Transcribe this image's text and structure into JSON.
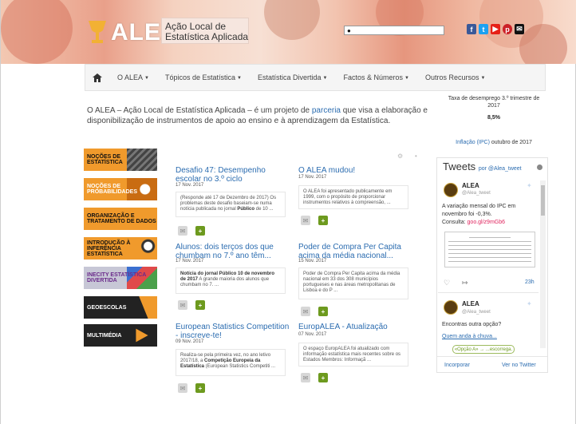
{
  "header": {
    "logo_text": "ALEA",
    "logo_subtitle_line1": "Ação Local de",
    "logo_subtitle_line2": "Estatística Aplicada",
    "search_placeholder": "",
    "social_icons": [
      "facebook-icon",
      "twitter-icon",
      "youtube-icon",
      "pinterest-icon",
      "email-icon"
    ]
  },
  "nav": {
    "home_icon": "home-icon",
    "items": [
      "O ALEA",
      "Tópicos de Estatística",
      "Estatística Divertida",
      "Factos & Números",
      "Outros Recursos"
    ]
  },
  "intro": {
    "before_link": "O ALEA – Ação Local de Estatística Aplicada – é um projeto de ",
    "link": "parceria",
    "after_link": " que visa a elaboração e disponibilização de instrumentos de apoio ao ensino e à aprendizagem da Estatística."
  },
  "right_top": {
    "line1": "Taxa de desemprego 3.º trimestre de",
    "line2": "2017",
    "value": "8,5%",
    "link": "Inflação (IPC)",
    "after_link": " outubro de 2017"
  },
  "categories": [
    {
      "label": "Noções de Estatística",
      "color": "#f09a2c"
    },
    {
      "label": "Noções de Probabilidades",
      "color": "#f09a2c"
    },
    {
      "label": "Organização e Tratamento de Dados",
      "color": "#f09a2c"
    },
    {
      "label": "Introdução à Inferência Estatística",
      "color": "#f09a2c"
    },
    {
      "label": "INECITY Estatística Divertida",
      "color": "#b8b8c8"
    },
    {
      "label": "Geoescolas",
      "color": "#222222"
    },
    {
      "label": "Multimédia",
      "color": "#222222"
    }
  ],
  "posts": [
    {
      "title": "Desafio 47: Desempenho escolar no 3.º ciclo",
      "date": "17 Nov. 2017",
      "excerpt_pre": "(Responde até 17 de Dezembro de 2017) Os problemas deste desafio baseiam-se numa notícia publicada no jornal ",
      "excerpt_bold": "Público",
      "excerpt_post": " de 10 ..."
    },
    {
      "title": "O ALEA mudou!",
      "date": "17 Nov. 2017",
      "excerpt_pre": "O ALEA foi apresentado publicamente em 1999, com o propósito de proporcionar instrumentos relativos à compreensão, ...",
      "excerpt_bold": "",
      "excerpt_post": ""
    },
    {
      "title": "Alunos: dois terços dos que chumbam no 7.º ano têm...",
      "date": "17 Nov. 2017",
      "excerpt_pre": "",
      "excerpt_bold": "Notícia do jornal Público 10 de novembro de 2017",
      "excerpt_post": " A grande maioria dos alunos que chumbam no 7. ..."
    },
    {
      "title": "Poder de Compra Per Capita acima da média nacional...",
      "date": "15 Nov. 2017",
      "excerpt_pre": "Poder de Compra Per Capita acima da média nacional em 33 dos 308 municípios portugueses e nas áreas metropolitanas de Lisboa e do P ...",
      "excerpt_bold": "",
      "excerpt_post": ""
    },
    {
      "title": "European Statistics Competition - inscreve-te!",
      "date": "09 Nov. 2017",
      "excerpt_pre": "Realiza-se pela primeira vez, no ano letivo 2017/18, a ",
      "excerpt_bold": "Competição Europeia da Estatística",
      "excerpt_post": " (European Statistics Competiti ..."
    },
    {
      "title": "EuropALEA - Atualização",
      "date": "07 Nov. 2017",
      "excerpt_pre": "O espaço EuropALEA foi atualizado com informação estatística mais recentes sobre os Estados Membros: Informaçã ...",
      "excerpt_bold": "",
      "excerpt_post": ""
    }
  ],
  "twitter": {
    "title": "Tweets",
    "by": "por @Alea_tweet",
    "tweet1": {
      "name": "ALEA",
      "handle": "@Alea_tweet",
      "text": "A variação mensal do IPC em novembro foi -0,3%.",
      "consult": "Consulta: ",
      "link": "goo.gl/z9mGb6",
      "time": "23h"
    },
    "tweet2": {
      "name": "ALEA",
      "handle": "@Alea_tweet",
      "text": "Encontras outra opção?",
      "link": "Quem anda à chuva...",
      "card": "«Opção A» → ...escorrega."
    },
    "footer_left": "Incorporar",
    "footer_right": "Ver no Twitter"
  },
  "colors": {
    "link": "#2b6cb0",
    "green_button": "#6d9a1e",
    "category_orange": "#f09a2c"
  }
}
